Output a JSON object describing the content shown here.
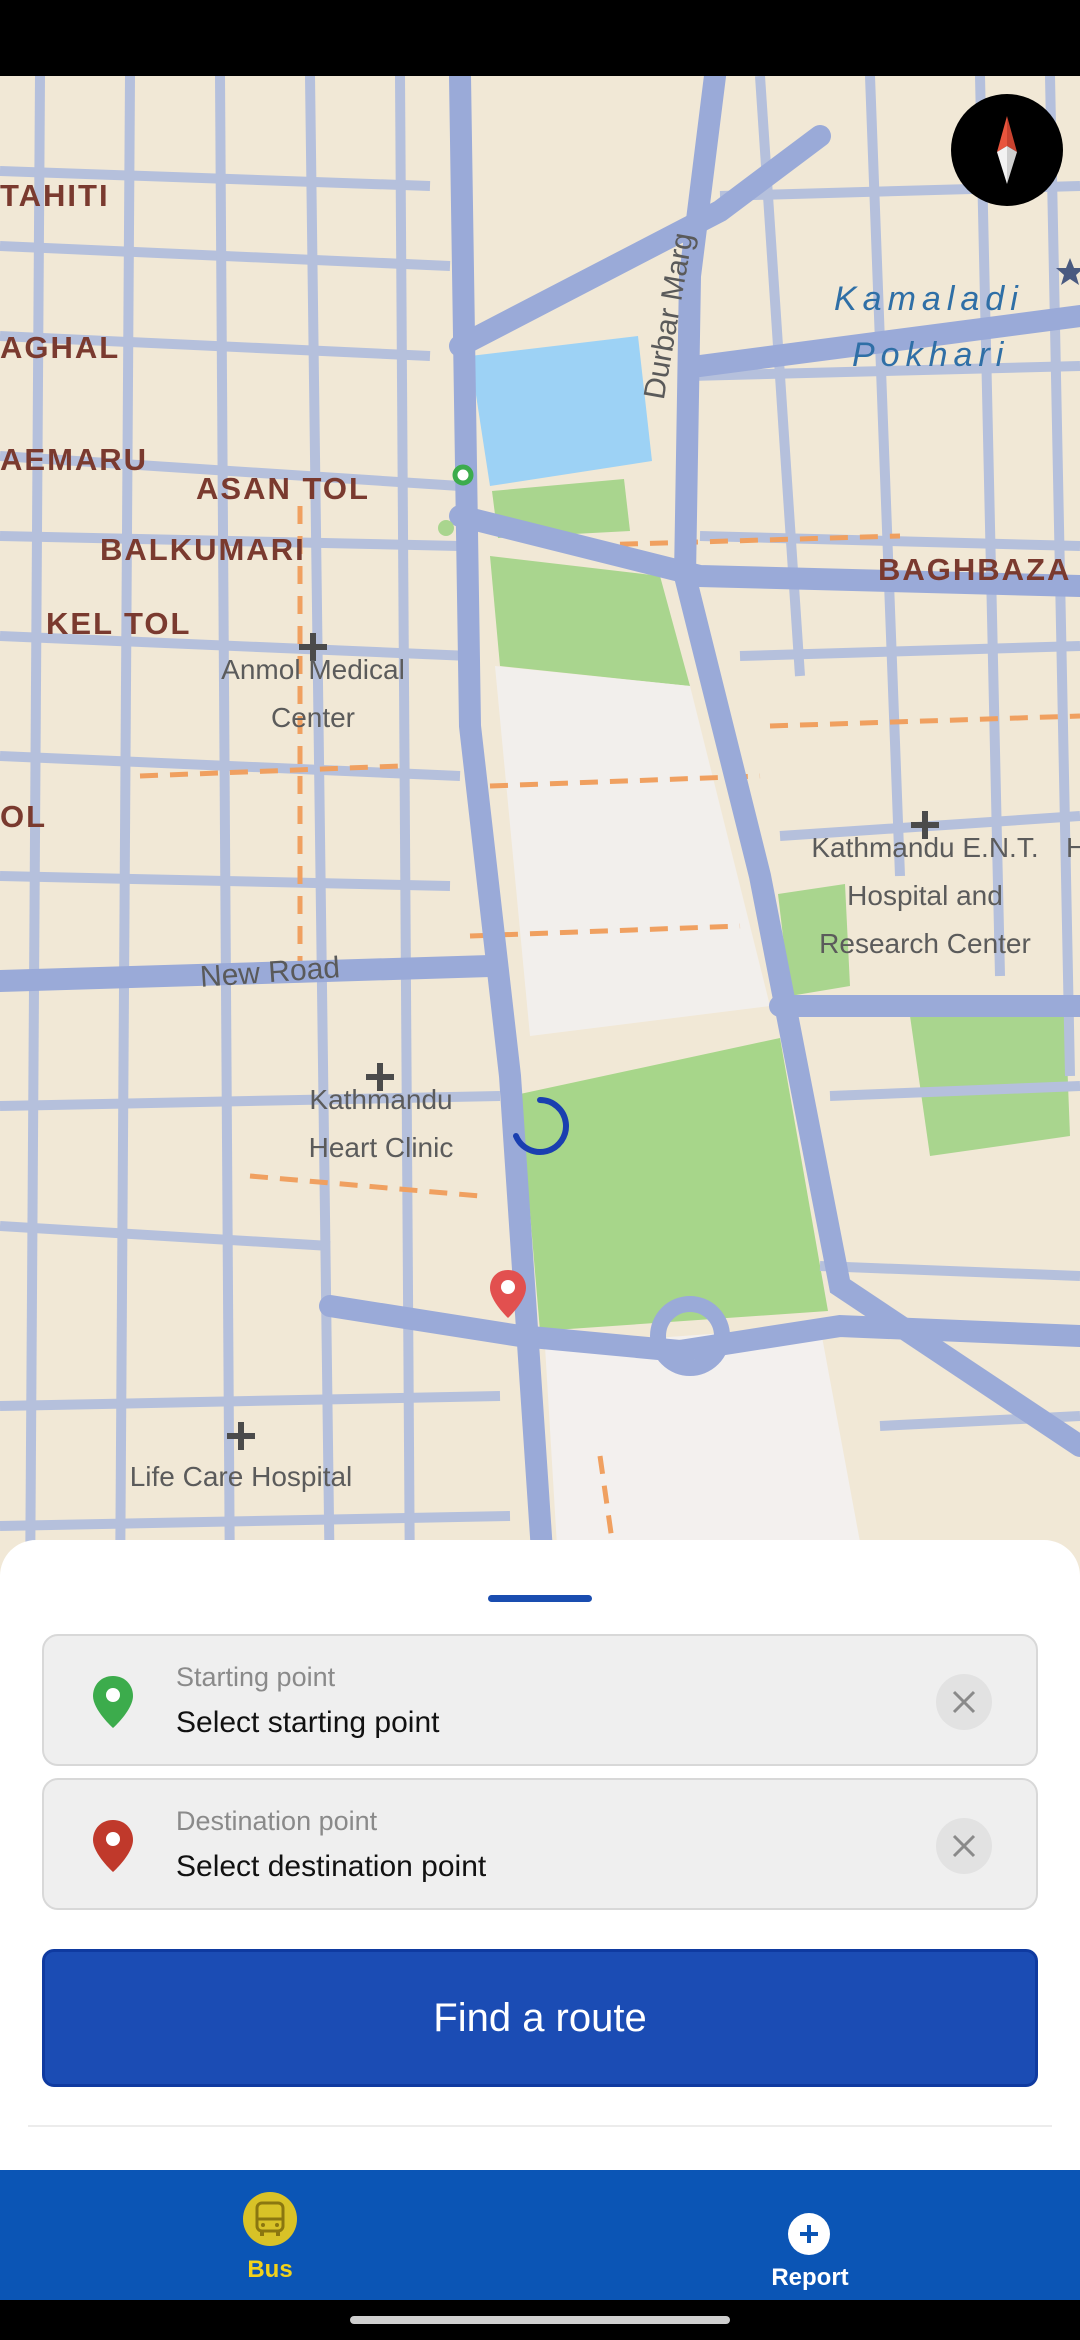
{
  "map": {
    "area_labels": [
      "TAHITI",
      "AGHAL",
      "AEMARU",
      "ASAN TOL",
      "BALKUMARI",
      "KEL TOL",
      "OL",
      "BAGHBAZA"
    ],
    "water_labels": [
      "Kamaladi",
      "Pokhari"
    ],
    "roads": [
      "Durbar Marg",
      "New Road"
    ],
    "pois": [
      {
        "line1": "Anmol Medical",
        "line2": "Center"
      },
      {
        "line1": "Kathmandu E.N.T.",
        "line2": "Hospital and",
        "line3": "Research Center"
      },
      {
        "line1": "Kathmandu",
        "line2": "Heart Clinic"
      },
      {
        "line1": "Life Care Hospital"
      }
    ],
    "edge_text": "H"
  },
  "icons": {
    "compass": "compass-icon",
    "start_pin": "location-pin-green-icon",
    "dest_pin": "location-pin-red-icon",
    "clear": "close-icon",
    "bus": "bus-icon",
    "report": "add-circle-icon",
    "loading": "loading-spinner-icon",
    "star": "star-icon"
  },
  "colors": {
    "primary": "#1b4cb4",
    "nav_bg": "#0b55b5",
    "nav_active": "#f2d21b",
    "start_pin": "#3cac4c",
    "dest_pin": "#c0392b"
  },
  "route_panel": {
    "start": {
      "caption": "Starting point",
      "value": "Select starting point"
    },
    "destination": {
      "caption": "Destination point",
      "value": "Select destination point"
    },
    "find_button": "Find a route"
  },
  "nav": {
    "items": [
      {
        "label": "Bus",
        "active": true
      },
      {
        "label": "Report",
        "active": false
      }
    ]
  }
}
